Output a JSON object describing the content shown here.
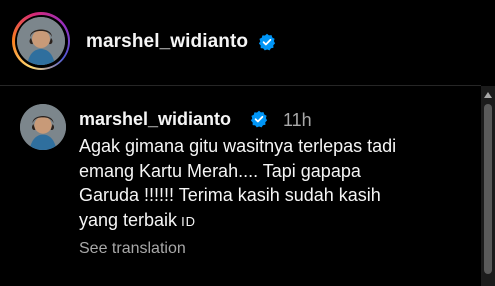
{
  "header": {
    "username": "marshel_widianto",
    "verified_icon": "verified-badge-icon",
    "badge_color": "#0095f6"
  },
  "comment": {
    "username": "marshel_widianto",
    "verified_icon": "verified-badge-icon",
    "time": "11h",
    "text": "Agak gimana gitu wasitnya terlepas tadi\nemang Kartu Merah.... Tapi gapapa\nGaruda !!!!!! Terima kasih sudah kasih\nyang terbaik",
    "language_tag": "ID",
    "see_translation": "See translation"
  },
  "colors": {
    "background": "#000000",
    "text": "#f5f5f5",
    "secondary_text": "#a8a8a8",
    "divider": "#262626"
  }
}
